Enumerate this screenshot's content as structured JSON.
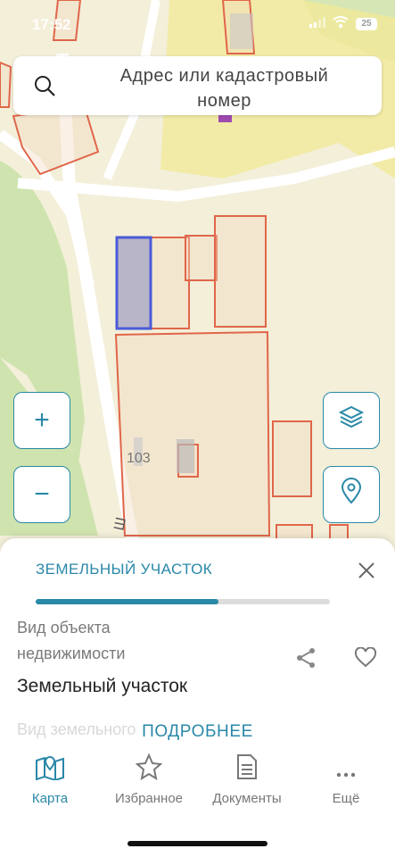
{
  "status_bar": {
    "time": "17:52",
    "battery": "25"
  },
  "search": {
    "placeholder": "Адрес или кадастровый номер"
  },
  "map": {
    "parcel_label": "103",
    "street_fragment": "Ш"
  },
  "map_controls": {
    "zoom_in": "+",
    "zoom_out": "−"
  },
  "sheet": {
    "title": "ЗЕМЕЛЬНЫЙ УЧАСТОК",
    "progress_fraction": 0.62,
    "field_label": "Вид объекта недвижимости",
    "field_value": "Земельный участок",
    "next_label_faded": "Вид земельного",
    "more_button": "ПОДРОБНЕЕ"
  },
  "tabs": [
    {
      "label": "Карта",
      "icon": "map-icon",
      "active": true
    },
    {
      "label": "Избранное",
      "icon": "star-icon",
      "active": false
    },
    {
      "label": "Документы",
      "icon": "document-icon",
      "active": false
    },
    {
      "label": "Ещё",
      "icon": "more-icon",
      "active": false
    }
  ],
  "colors": {
    "accent": "#2a88a8",
    "parcel_outline": "#e0664a",
    "selected_parcel": "#4a5bd8"
  }
}
